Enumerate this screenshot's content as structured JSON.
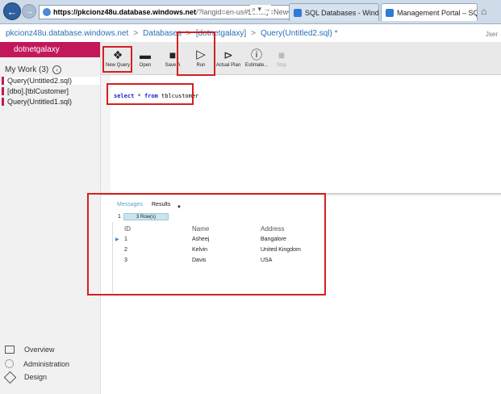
{
  "browser": {
    "url_host": "https://pkcionz48u.database.windows.net",
    "url_rest": "/?langid=en-us#$entity=NewQuery&id=",
    "url_tools": "⌕ ▾ →",
    "tabs": [
      {
        "label": "SQL Databases - Windows Azure",
        "close": "×"
      },
      {
        "label": "Management Portal – SQL ...",
        "close": "×"
      }
    ]
  },
  "breadcrumb": {
    "items": [
      "pkcionz48u.database.windows.net",
      "Databases",
      "[dotnetgalaxy]",
      "Query(Untitled2.sql) *"
    ],
    "separator": ">"
  },
  "user": "Jser",
  "sidebar": {
    "database": "dotnetgalaxy",
    "mywork_title": "My Work (3)",
    "mywork_icon": "‹",
    "items": [
      {
        "label": "Query(Untitled2.sql)"
      },
      {
        "label": "[dbo].[tblCustomer]"
      },
      {
        "label": "Query(Untitled1.sql)"
      }
    ],
    "nav": [
      {
        "label": "Overview",
        "icon": "overview-icon"
      },
      {
        "label": "Administration",
        "icon": "administration-icon"
      },
      {
        "label": "Design",
        "icon": "design-icon"
      }
    ]
  },
  "toolbar": {
    "buttons": [
      {
        "label": "New Query",
        "glyph": "❖",
        "enabled": true
      },
      {
        "label": "Open",
        "glyph": "▬",
        "enabled": true
      },
      {
        "label": "Save A",
        "glyph": "■",
        "enabled": true
      },
      {
        "label": "Run",
        "glyph": "▷",
        "enabled": true
      },
      {
        "label": "Actual Plan",
        "glyph": "⊳",
        "enabled": true
      },
      {
        "label": "Estimate...",
        "glyph": "ⓘ",
        "enabled": true
      },
      {
        "label": "Stop",
        "glyph": "■",
        "enabled": false
      }
    ]
  },
  "editor": {
    "keyword1": "select",
    "star": " * ",
    "keyword2": "from",
    "table": " tblcustomer"
  },
  "results": {
    "tab_messages": "Messages",
    "tab_results": "Results",
    "batch": "1",
    "row_count": "3 Row(s)",
    "row_indicator": "▶",
    "columns": [
      "ID",
      "Name",
      "Address"
    ],
    "rows": [
      [
        "1",
        "Asheej",
        "Bangalore"
      ],
      [
        "2",
        "Kelvin",
        "United Kingdom"
      ],
      [
        "3",
        "Davis",
        "USA"
      ]
    ]
  },
  "colors": {
    "accent": "#c2185b",
    "highlight": "#d42020",
    "link": "#2a6fb3"
  }
}
